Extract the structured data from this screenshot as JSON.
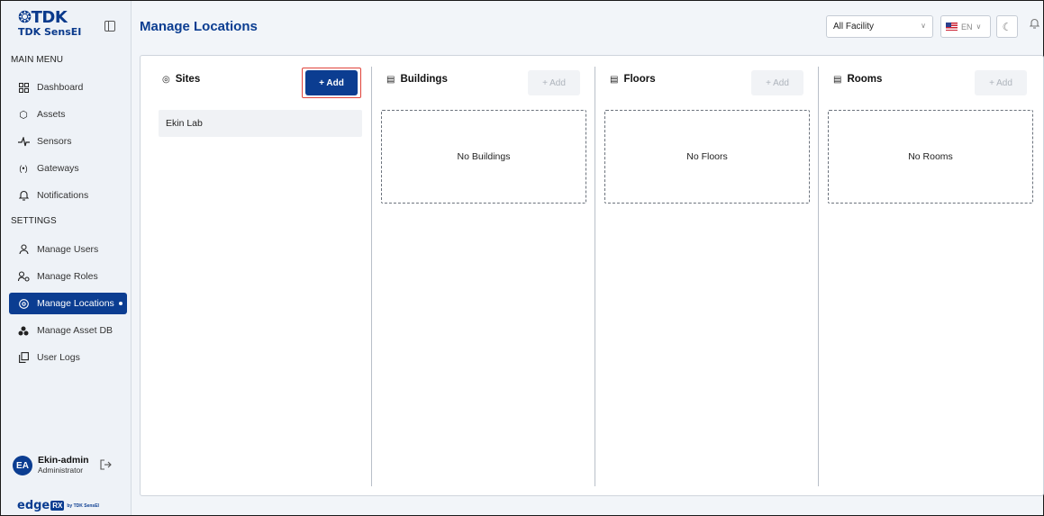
{
  "brand": {
    "logo_text": "TDK",
    "sub": "TDK SensEI"
  },
  "sidebar": {
    "main_menu_title": "MAIN MENU",
    "main_items": [
      {
        "label": "Dashboard",
        "icon": "dashboard-icon"
      },
      {
        "label": "Assets",
        "icon": "cube-icon"
      },
      {
        "label": "Sensors",
        "icon": "pulse-icon"
      },
      {
        "label": "Gateways",
        "icon": "wireless-icon"
      },
      {
        "label": "Notifications",
        "icon": "bell-icon"
      }
    ],
    "settings_title": "SETTINGS",
    "settings_items": [
      {
        "label": "Manage Users",
        "icon": "user-icon"
      },
      {
        "label": "Manage Roles",
        "icon": "user-key-icon"
      },
      {
        "label": "Manage Locations",
        "icon": "location-pin-icon",
        "active": true
      },
      {
        "label": "Manage Asset DB",
        "icon": "database-icon"
      },
      {
        "label": "User Logs",
        "icon": "copy-icon"
      }
    ],
    "user": {
      "initials": "EA",
      "name": "Ekin-admin",
      "role": "Administrator"
    },
    "footer_logo": {
      "edge": "edge",
      "rx": "RX",
      "by": "by TDK SensEI"
    }
  },
  "header": {
    "title": "Manage Locations",
    "facility_select": {
      "value": "All Facility"
    },
    "language": {
      "value": "EN"
    }
  },
  "columns": {
    "sites": {
      "title": "Sites",
      "add_label": "+ Add",
      "items": [
        "Ekin Lab"
      ]
    },
    "buildings": {
      "title": "Buildings",
      "add_label": "+ Add",
      "empty": "No Buildings"
    },
    "floors": {
      "title": "Floors",
      "add_label": "+ Add",
      "empty": "No Floors"
    },
    "rooms": {
      "title": "Rooms",
      "add_label": "+ Add",
      "empty": "No Rooms"
    }
  },
  "colors": {
    "primary": "#0b3d91",
    "highlight_outline": "#e0433a"
  }
}
